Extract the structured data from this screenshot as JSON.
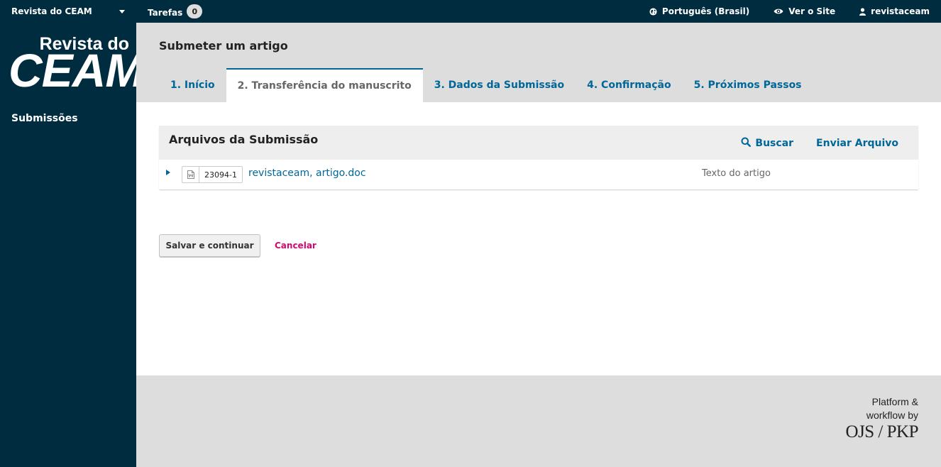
{
  "topbar": {
    "journal_name": "Revista do CEAM",
    "tasks_label": "Tarefas",
    "tasks_count": "0",
    "language": "Português (Brasil)",
    "view_site": "Ver o Site",
    "username": "revistaceam"
  },
  "sidebar": {
    "logo_line1": "Revista do",
    "logo_line2": "CEAM",
    "nav_submissions": "Submissões"
  },
  "header": {
    "title": "Submeter um artigo",
    "tabs": [
      {
        "label": "1. Início"
      },
      {
        "label": "2. Transferência do manuscrito"
      },
      {
        "label": "3. Dados da Submissão"
      },
      {
        "label": "4. Confirmação"
      },
      {
        "label": "5. Próximos Passos"
      }
    ],
    "active_tab": 1
  },
  "files_grid": {
    "title": "Arquivos da Submissão",
    "search_label": "Buscar",
    "upload_label": "Enviar Arquivo",
    "rows": [
      {
        "id": "23094-1",
        "name": "revistaceam, artigo.doc",
        "type": "Texto do artigo"
      }
    ]
  },
  "actions": {
    "save_label": "Salvar e continuar",
    "cancel_label": "Cancelar"
  },
  "footer": {
    "line1": "Platform &",
    "line2": "workflow by",
    "line3": "OJS / PKP"
  },
  "colors": {
    "navy": "#002c40",
    "link_blue": "#006798",
    "cancel_pink": "#d00a6c"
  },
  "icons": [
    "caret-down-icon",
    "globe-icon",
    "eye-icon",
    "user-icon",
    "search-icon",
    "word-file-icon",
    "expand-arrow-icon"
  ]
}
